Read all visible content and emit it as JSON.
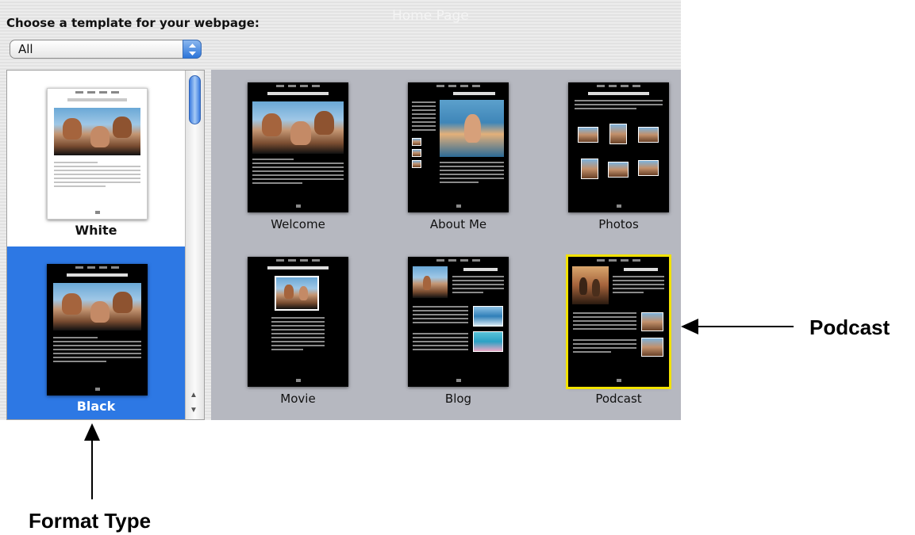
{
  "dialog": {
    "prompt": "Choose a template for your webpage:",
    "ghost_title": "Home Page",
    "filter": {
      "selected": "All"
    }
  },
  "templates": [
    {
      "name": "White",
      "thumb_title": "Ligula nostra taciti"
    },
    {
      "name": "Black",
      "thumb_title": "Ligula nostra taciti",
      "selected": true
    }
  ],
  "pages": [
    {
      "label": "Welcome",
      "thumb_title": "Ligula nostra taciti"
    },
    {
      "label": "About Me",
      "thumb_title": "Ut wisi enim minim"
    },
    {
      "label": "Photos",
      "thumb_title": "Nam liber tempo soluta"
    },
    {
      "label": "Movie",
      "thumb_title": "Blandit praesent lupta"
    },
    {
      "label": "Blog",
      "thumb_title": "Sit Amet"
    },
    {
      "label": "Podcast",
      "thumb_title": "Sit Amet",
      "selected": true
    }
  ],
  "annotations": {
    "podcast": "Podcast",
    "format_type": "Format Type"
  },
  "colors": {
    "selection_blue": "#2d78e4",
    "grid_background": "#b6b8c0",
    "selected_outline": "#f2e200"
  }
}
